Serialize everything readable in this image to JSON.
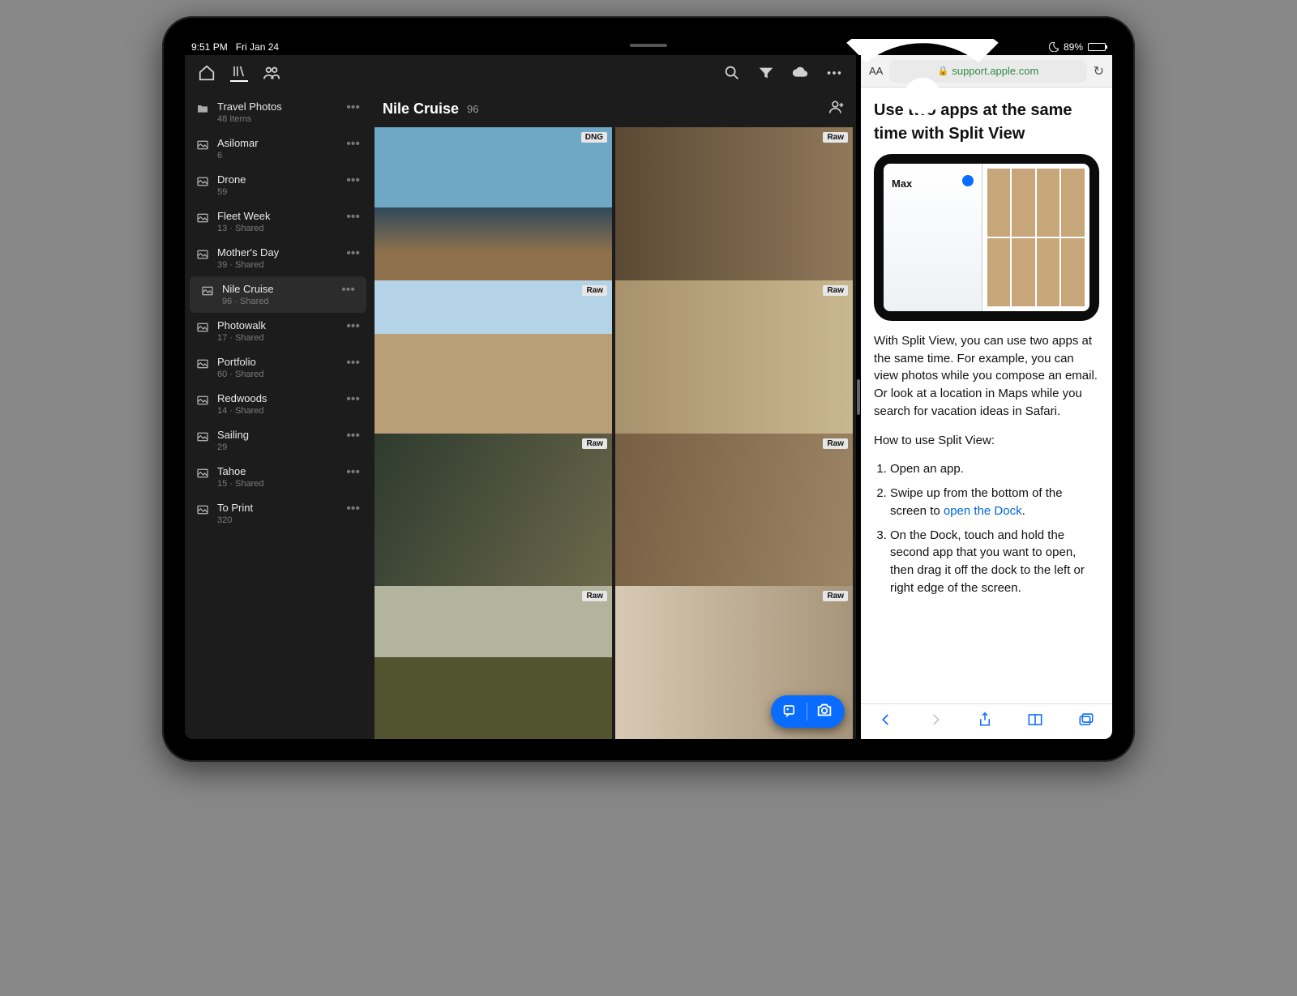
{
  "status": {
    "time": "9:51 PM",
    "date": "Fri Jan 24",
    "battery_pct": "89%"
  },
  "lightroom": {
    "header": {
      "title": "Nile Cruise",
      "count": "96"
    },
    "sidebar": [
      {
        "icon": "folder",
        "name": "Travel Photos",
        "meta": "48 Items"
      },
      {
        "icon": "album",
        "name": "Asilomar",
        "meta": "6"
      },
      {
        "icon": "album",
        "name": "Drone",
        "meta": "59"
      },
      {
        "icon": "album",
        "name": "Fleet Week",
        "meta": "13 · Shared"
      },
      {
        "icon": "album",
        "name": "Mother's Day",
        "meta": "39 · Shared"
      },
      {
        "icon": "album",
        "name": "Nile Cruise",
        "meta": "96 · Shared",
        "selected": true
      },
      {
        "icon": "album",
        "name": "Photowalk",
        "meta": "17 · Shared"
      },
      {
        "icon": "album",
        "name": "Portfolio",
        "meta": "60 · Shared"
      },
      {
        "icon": "album",
        "name": "Redwoods",
        "meta": "14 · Shared"
      },
      {
        "icon": "album",
        "name": "Sailing",
        "meta": "29"
      },
      {
        "icon": "album",
        "name": "Tahoe",
        "meta": "15 · Shared"
      },
      {
        "icon": "album",
        "name": "To Print",
        "meta": "320"
      }
    ],
    "thumbs": [
      {
        "badge": "DNG"
      },
      {
        "badge": "Raw"
      },
      {
        "badge": "Raw"
      },
      {
        "badge": "Raw"
      },
      {
        "badge": "Raw"
      },
      {
        "badge": "Raw"
      },
      {
        "badge": "Raw"
      },
      {
        "badge": "Raw"
      }
    ]
  },
  "safari": {
    "url": "support.apple.com",
    "title": "Use two apps at the same time with Split View",
    "para": "With Split View, you can use two apps at the same time. For example, you can view photos while you compose an email. Or look at a location in Maps while you search for vacation ideas in Safari.",
    "howto_label": "How to use Split View:",
    "steps": {
      "s1": "Open an app.",
      "s2a": "Swipe up from the bottom of the screen to ",
      "s2link": "open the Dock",
      "s2b": ".",
      "s3": "On the Dock, touch and hold the second app that you want to open, then drag it off the dock to the left or right edge of the screen."
    }
  }
}
